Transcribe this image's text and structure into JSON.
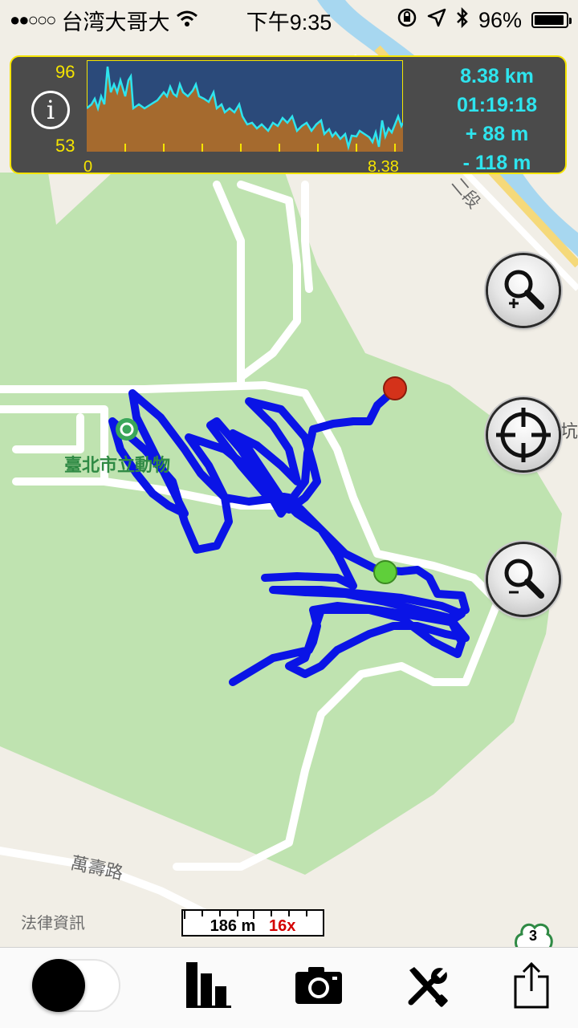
{
  "status_bar": {
    "signal": "●●○○○",
    "carrier": "台湾大哥大",
    "time": "下午9:35",
    "battery": "96%",
    "battery_level": 0.96,
    "icons": [
      "wifi-icon",
      "rotation-lock-icon",
      "location-arrow-icon",
      "bluetooth-icon",
      "battery-icon"
    ]
  },
  "stats_panel": {
    "info_label": "i",
    "elevation_max": "96",
    "elevation_min": "53",
    "distance_start": "0",
    "distance_end": "8.38",
    "distance": "8.38 km",
    "duration": "01:19:18",
    "ascent": "+ 88 m",
    "descent": "- 118 m",
    "colors": {
      "border": "#f5e400",
      "labels": "#f5e400",
      "values": "#2ee4ee",
      "chart_bg": "#2b4a7a",
      "chart_fill": "#a56a2e",
      "chart_line": "#2ee4ee"
    }
  },
  "map": {
    "park_label": "臺北市立動物",
    "road_label_1": "萬壽路",
    "road_label_2": "二段",
    "side_label": "坑",
    "legal_link": "法律資訊",
    "scale_distance": "186 m",
    "scale_zoom": "16x",
    "highway_number": "3",
    "colors": {
      "park": "#bfe3b0",
      "land": "#f1eee6",
      "road": "#ffffff",
      "river": "#a7d7f0",
      "track": "#0a14e6",
      "start": "#5fcf3a",
      "end": "#d4321a"
    }
  },
  "map_controls": {
    "zoom_in": "zoom-in-icon",
    "locate": "crosshair-icon",
    "zoom_out": "zoom-out-icon"
  },
  "toolbar": {
    "icons": [
      "record-toggle",
      "bar-chart-icon",
      "camera-icon",
      "tools-icon",
      "share-icon"
    ]
  }
}
